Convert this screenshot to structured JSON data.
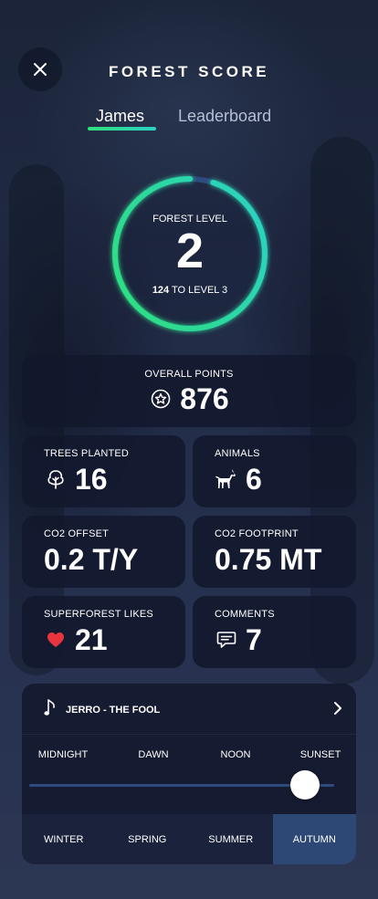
{
  "header": {
    "title": "FOREST SCORE",
    "close_icon": "close-icon"
  },
  "tabs": [
    {
      "label": "James",
      "active": true
    },
    {
      "label": "Leaderboard",
      "active": false
    }
  ],
  "level": {
    "label": "FOREST LEVEL",
    "value": "2",
    "to_next_number": "124",
    "to_next_text": "TO LEVEL 3",
    "progress": 0.95
  },
  "overall": {
    "label": "OVERALL POINTS",
    "value": "876",
    "icon": "star-badge-icon"
  },
  "stats": [
    {
      "label": "TREES PLANTED",
      "value": "16",
      "icon": "tree-icon"
    },
    {
      "label": "ANIMALS",
      "value": "6",
      "icon": "deer-icon"
    },
    {
      "label": "CO2 OFFSET",
      "value": "0.2 T/Y",
      "icon": ""
    },
    {
      "label": "CO2 FOOTPRINT",
      "value": "0.75 MT",
      "icon": ""
    },
    {
      "label": "SUPERFOREST LIKES",
      "value": "21",
      "icon": "heart-icon"
    },
    {
      "label": "COMMENTS",
      "value": "7",
      "icon": "comment-icon"
    }
  ],
  "music": {
    "song": "JERRO - THE FOOL",
    "note_icon": "music-note-icon",
    "chevron_icon": "chevron-right-icon"
  },
  "time_of_day": {
    "labels": [
      "MIDNIGHT",
      "DAWN",
      "NOON",
      "SUNSET"
    ],
    "slider_value": 1.0
  },
  "seasons": {
    "items": [
      "WINTER",
      "SPRING",
      "SUMMER",
      "AUTUMN"
    ],
    "active": "AUTUMN"
  },
  "colors": {
    "ring_start": "#2de07a",
    "ring_end": "#2cd1c6",
    "ring_track": "#2f4a7d",
    "heart": "#e8343f",
    "season_active": "#2e4876"
  }
}
